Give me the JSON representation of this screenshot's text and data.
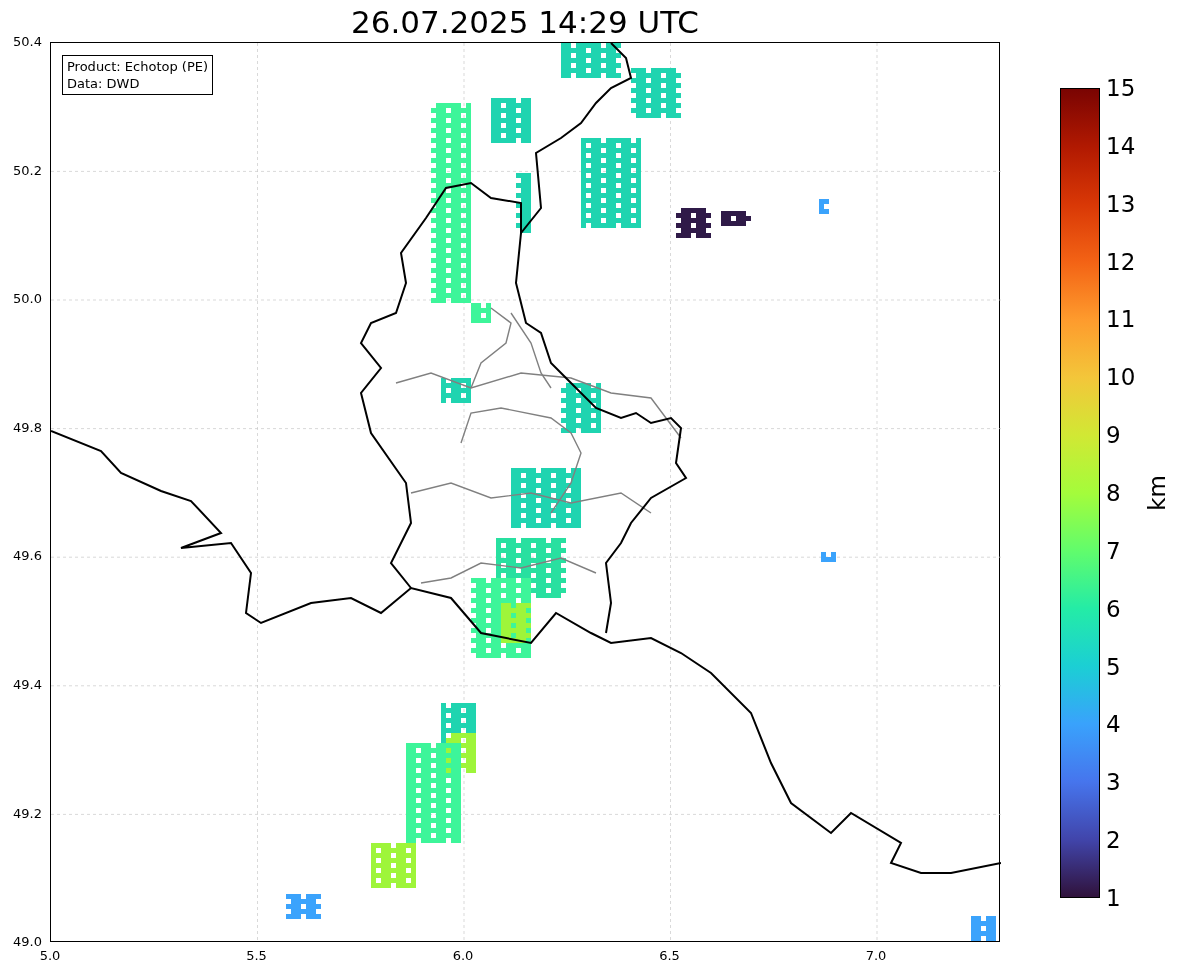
{
  "figure": {
    "title": "26.07.2025 14:29 UTC"
  },
  "map": {
    "legend": [
      "Product: Echotop (PE)",
      "Data: DWD"
    ],
    "x_tick_labels": [
      "5.0",
      "5.5",
      "6.0",
      "6.5",
      "7.0"
    ],
    "y_tick_labels": [
      "50.4",
      "50.2",
      "50.0",
      "49.8",
      "49.6",
      "49.4",
      "49.2",
      "49.0"
    ]
  },
  "colorbar": {
    "label": "km",
    "tick_labels": [
      "15",
      "14",
      "13",
      "12",
      "11",
      "10",
      "9",
      "8",
      "7",
      "6",
      "5",
      "4",
      "3",
      "2",
      "1"
    ]
  }
}
